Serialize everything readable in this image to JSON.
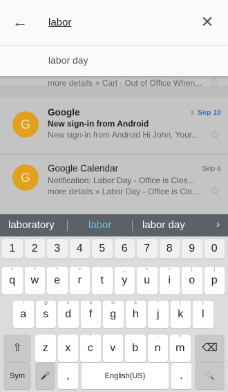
{
  "search": {
    "query": "labor",
    "suggestion": "labor day"
  },
  "icons": {
    "back": "arrow-left-icon",
    "clear": "close-icon",
    "star": "star-outline-icon",
    "attachment": "paperclip-icon"
  },
  "mails": [
    {
      "snippet": "more details » Carl - Out of Office When..."
    },
    {
      "avatar": "G",
      "sender": "Google",
      "date": "Sep 10",
      "subject": "New sign-in from Android",
      "snippet": "New sign-in from Android Hi John, Your..."
    },
    {
      "avatar": "G",
      "sender": "Google Calendar",
      "date": "Sep 6",
      "subject": "Notification: Labor Day - Office is Clos...",
      "snippet": "more details » Labor Day - Office is Clo..."
    }
  ],
  "predictions": {
    "left": "laboratory",
    "center": "labor",
    "right": "labor day",
    "more": "›"
  },
  "keyboard": {
    "numbers": [
      "1",
      "2",
      "3",
      "4",
      "5",
      "6",
      "7",
      "8",
      "9",
      "0"
    ],
    "row1": [
      "q",
      "w",
      "e",
      "r",
      "t",
      "y",
      "u",
      "i",
      "o",
      "p"
    ],
    "row1_hints": [
      "+",
      "×",
      "÷",
      "=",
      "/",
      "_",
      "<",
      ">",
      "[",
      "]"
    ],
    "row2": [
      "a",
      "s",
      "d",
      "f",
      "g",
      "h",
      "j",
      "k",
      "l"
    ],
    "row2_hints": [
      "!",
      "@",
      "#",
      "$",
      "%",
      "&",
      "*",
      "(",
      ")"
    ],
    "row3": [
      "z",
      "x",
      "c",
      "v",
      "b",
      "n",
      "m"
    ],
    "row3_hints": [
      "-",
      "'",
      "\"",
      ":",
      ";",
      "!",
      "?"
    ],
    "shift": "⇧",
    "backspace": "⌫",
    "sym": "Sym",
    "mic": "🎤",
    "comma": ",",
    "space": "English(US)",
    "period": ".",
    "search": "🔍"
  },
  "colors": {
    "accent": "#54c8f0",
    "avatar": "#e0a020",
    "date_highlight": "#2b74c7"
  }
}
